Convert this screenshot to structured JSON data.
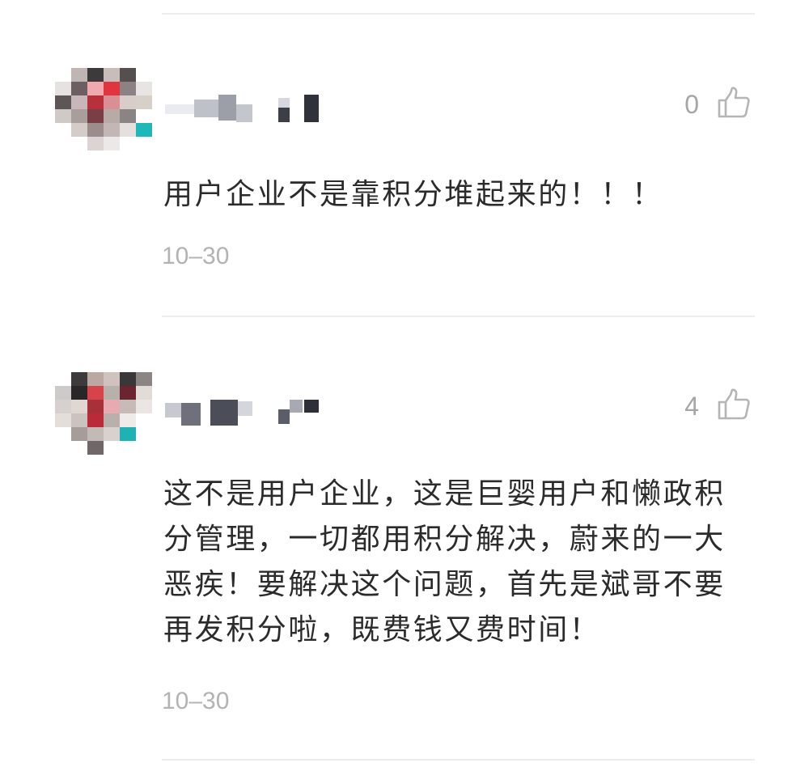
{
  "comments": [
    {
      "likes": "0",
      "text": "用户企业不是靠积分堆起来的！！！",
      "date": "10–30"
    },
    {
      "likes": "4",
      "text": "这不是用户企业，这是巨婴用户和懒政积分管理，一切都用积分解决，蔚来的一大恶疾！要解决这个问题，首先是斌哥不要再发积分啦，既费钱又费时间！",
      "date": "10–30"
    }
  ],
  "icons": {
    "like": "thumbs-up-icon"
  },
  "colors": {
    "text": "#2b2b2b",
    "muted": "#a6a6a6",
    "divider": "#ededed"
  }
}
